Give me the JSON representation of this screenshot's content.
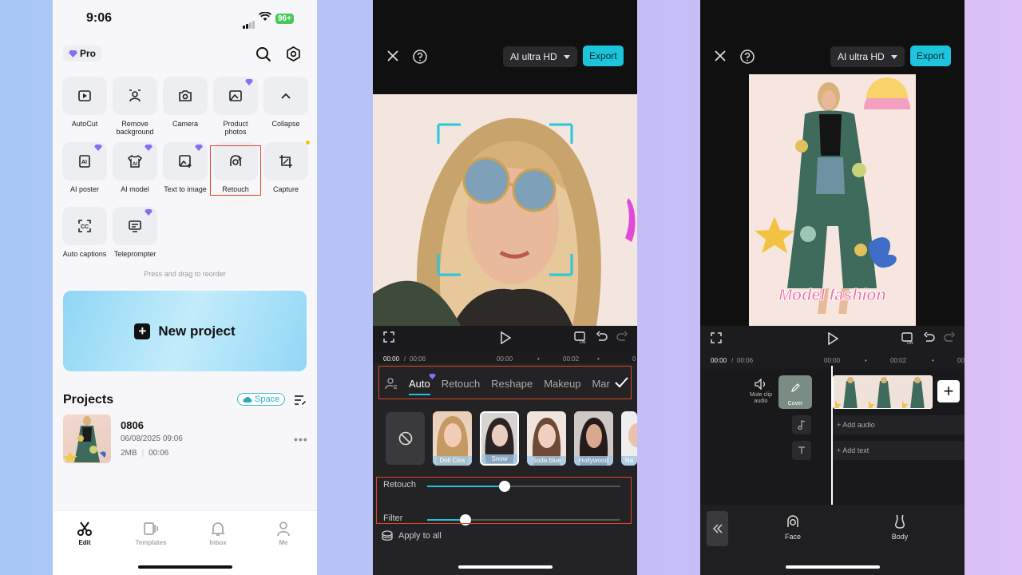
{
  "home": {
    "status": {
      "time": "9:06",
      "battery": "96+"
    },
    "pro_label": "Pro",
    "tools": [
      {
        "label": "AutoCut",
        "icon": "autocut-icon"
      },
      {
        "label": "Remove background",
        "icon": "remove-background-icon"
      },
      {
        "label": "Camera",
        "icon": "camera-icon"
      },
      {
        "label": "Product photos",
        "icon": "product-photos-icon"
      },
      {
        "label": "Collapse",
        "icon": "chevron-up-icon"
      },
      {
        "label": "AI poster",
        "icon": "ai-poster-icon"
      },
      {
        "label": "AI model",
        "icon": "ai-model-icon"
      },
      {
        "label": "Text to image",
        "icon": "text-to-image-icon"
      },
      {
        "label": "Retouch",
        "icon": "retouch-icon"
      },
      {
        "label": "Capture",
        "icon": "capture-icon"
      },
      {
        "label": "Auto captions",
        "icon": "auto-captions-icon"
      },
      {
        "label": "Teleprompter",
        "icon": "teleprompter-icon"
      }
    ],
    "reorder_hint": "Press and drag to reorder",
    "new_project_label": "New project",
    "projects_title": "Projects",
    "space_label": "Space",
    "project": {
      "name": "0806",
      "date": "06/08/2025 09:06",
      "size": "2MB",
      "duration": "00:06"
    },
    "tabs": [
      {
        "label": "Edit"
      },
      {
        "label": "Templates"
      },
      {
        "label": "Inbox"
      },
      {
        "label": "Me"
      }
    ]
  },
  "retouch_editor": {
    "quality_label": "AI ultra HD",
    "export_label": "Export",
    "time_current": "00:00",
    "time_total": "00:06",
    "ruler_marks": [
      "00:00",
      "00:02",
      "0"
    ],
    "feature_tabs": [
      "Auto",
      "Retouch",
      "Reshape",
      "Makeup",
      "Mar"
    ],
    "presets": [
      "Doll Clos",
      "Snow",
      "Soda blue",
      "Hollywood",
      "Na"
    ],
    "sliders": [
      {
        "label": "Retouch",
        "value": 0.4
      },
      {
        "label": "Filter",
        "value": 0.2
      }
    ],
    "apply_all_label": "Apply to all",
    "accent": "#1dc5dc"
  },
  "body_editor": {
    "quality_label": "AI ultra HD",
    "export_label": "Export",
    "canvas_text": "Model fashion",
    "time_current": "00:00",
    "time_total": "00:06",
    "ruler_marks": [
      "00:00",
      "00:02",
      "00"
    ],
    "mute_label": "Mute clip audio",
    "cover_label": "Cover",
    "add_audio_label": "+ Add audio",
    "add_text_label": "+ Add text",
    "bottom_tools": [
      {
        "label": "Face"
      },
      {
        "label": "Body"
      }
    ]
  }
}
